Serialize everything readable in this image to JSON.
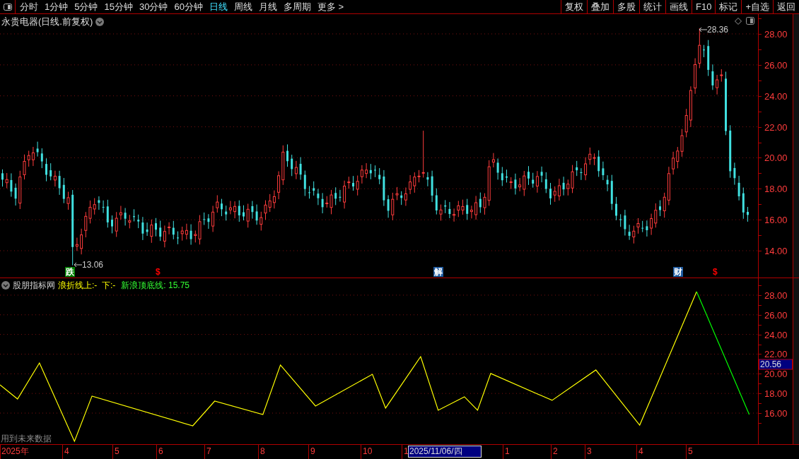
{
  "toolbar": {
    "periods": [
      {
        "label": "分时",
        "selected": false
      },
      {
        "label": "1分钟",
        "selected": false
      },
      {
        "label": "5分钟",
        "selected": false
      },
      {
        "label": "15分钟",
        "selected": false
      },
      {
        "label": "30分钟",
        "selected": false
      },
      {
        "label": "60分钟",
        "selected": false
      },
      {
        "label": "日线",
        "selected": true
      },
      {
        "label": "周线",
        "selected": false
      },
      {
        "label": "月线",
        "selected": false
      },
      {
        "label": "多周期",
        "selected": false
      },
      {
        "label": "更多 >",
        "selected": false
      }
    ],
    "buttons": [
      "复权",
      "叠加",
      "多股",
      "统计",
      "画线",
      "F10",
      "标记",
      "+自选",
      "返回"
    ]
  },
  "price_chart": {
    "title": "永贵电器(日线.前复权)",
    "high_label": "28.36",
    "low_label": "13.06",
    "axis_labels": [
      "28.00",
      "26.00",
      "24.00",
      "22.00",
      "20.00",
      "18.00",
      "16.00",
      "14.00"
    ],
    "markers": [
      {
        "text": "跌",
        "color": "#008000"
      },
      {
        "text": "$",
        "color": "#ff0000"
      },
      {
        "text": "解",
        "color": "#1e5aa0"
      },
      {
        "text": "财",
        "color": "#1e5aa0"
      },
      {
        "text": "$",
        "color": "#ff0000"
      }
    ]
  },
  "indicator": {
    "name": "股朋指标网",
    "legend_line": "浪折线上:-  下:-",
    "legend_band": "新浪顶底线: 15.75",
    "cursor_value": "20.56",
    "note": "用到未来数据",
    "axis_labels": [
      "28.00",
      "26.00",
      "24.00",
      "22.00",
      "20.00",
      "18.00",
      "16.00"
    ]
  },
  "date_axis": {
    "labels": [
      {
        "text": "2025年",
        "selected": false
      },
      {
        "text": "4",
        "selected": false
      },
      {
        "text": "5",
        "selected": false
      },
      {
        "text": "6",
        "selected": false
      },
      {
        "text": "7",
        "selected": false
      },
      {
        "text": "8",
        "selected": false
      },
      {
        "text": "9",
        "selected": false
      },
      {
        "text": "10",
        "selected": false
      },
      {
        "text": "1",
        "selected": false
      },
      {
        "text": "2025/11/06/四",
        "selected": true
      },
      {
        "text": "1",
        "selected": false
      },
      {
        "text": "2",
        "selected": false
      },
      {
        "text": "3",
        "selected": false
      },
      {
        "text": "4",
        "selected": false
      },
      {
        "text": "5",
        "selected": false
      }
    ]
  }
}
